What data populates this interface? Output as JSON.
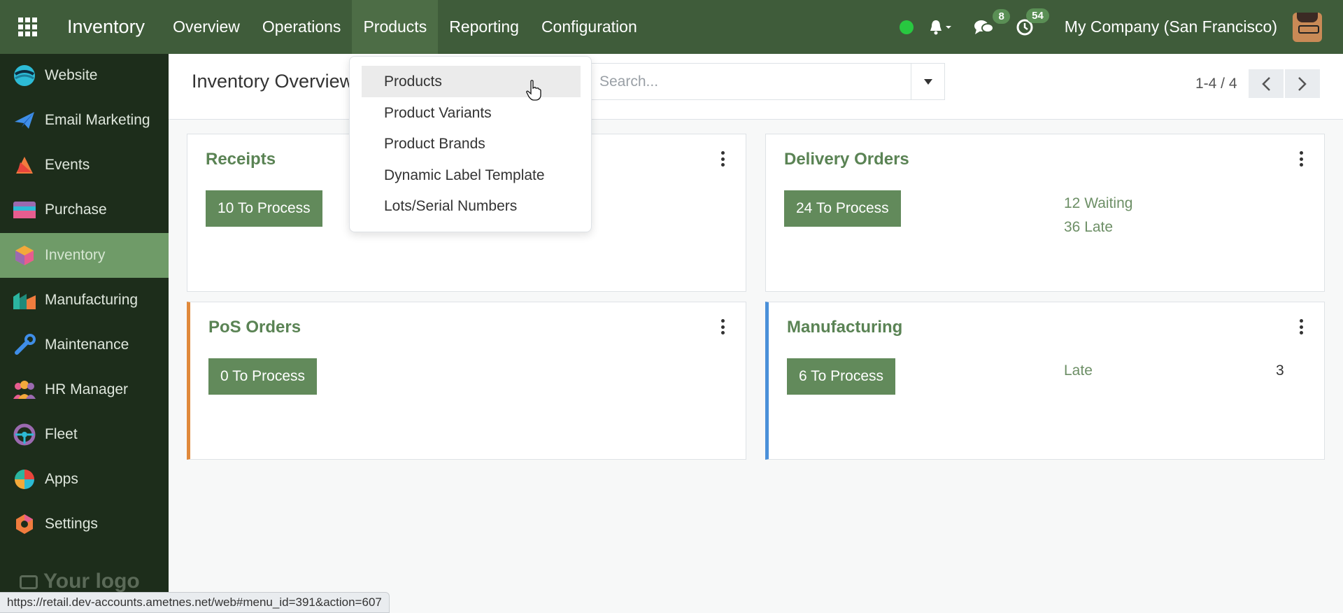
{
  "navbar": {
    "brand": "Inventory",
    "menu": [
      "Overview",
      "Operations",
      "Products",
      "Reporting",
      "Configuration"
    ],
    "chat_count": "8",
    "activity_count": "54",
    "company": "My Company (San Francisco)"
  },
  "sidebar": {
    "items": [
      {
        "label": "Website",
        "icon": "website-icon"
      },
      {
        "label": "Email Marketing",
        "icon": "email-marketing-icon"
      },
      {
        "label": "Events",
        "icon": "events-icon"
      },
      {
        "label": "Purchase",
        "icon": "purchase-icon"
      },
      {
        "label": "Inventory",
        "icon": "inventory-icon"
      },
      {
        "label": "Manufacturing",
        "icon": "manufacturing-icon"
      },
      {
        "label": "Maintenance",
        "icon": "maintenance-icon"
      },
      {
        "label": "HR Manager",
        "icon": "hr-manager-icon"
      },
      {
        "label": "Fleet",
        "icon": "fleet-icon"
      },
      {
        "label": "Apps",
        "icon": "apps-icon"
      },
      {
        "label": "Settings",
        "icon": "settings-icon"
      }
    ],
    "active": "Inventory",
    "logo_text": "Your logo"
  },
  "control_panel": {
    "title": "Inventory Overview",
    "search_placeholder": "Search...",
    "pager_value": "1-4 / 4"
  },
  "products_menu": {
    "items": [
      "Products",
      "Product Variants",
      "Product Brands",
      "Dynamic Label Template",
      "Lots/Serial Numbers"
    ],
    "hovered": "Products"
  },
  "cards": {
    "receipts": {
      "title": "Receipts",
      "button": "10 To Process"
    },
    "delivery": {
      "title": "Delivery Orders",
      "button": "24 To Process",
      "waiting": "12 Waiting",
      "late": "36 Late"
    },
    "pos": {
      "title": "PoS Orders",
      "button": "0 To Process"
    },
    "manufacturing": {
      "title": "Manufacturing",
      "button": "6 To Process",
      "late_label": "Late",
      "late_value": "3"
    }
  },
  "statusbar": {
    "url": "https://retail.dev-accounts.ametnes.net/web#menu_id=391&action=607"
  },
  "colors": {
    "navbar": "#3f5c3a",
    "sidebar": "#1d2d1b",
    "accent_green": "#628a5b",
    "pos_border": "#e0893b",
    "manufacturing_border": "#4a90d9"
  }
}
